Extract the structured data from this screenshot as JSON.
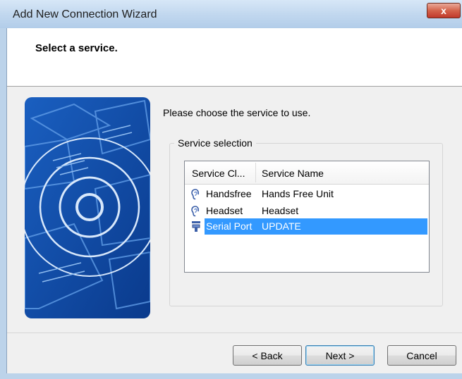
{
  "window": {
    "title": "Add New Connection Wizard",
    "close_glyph": "x"
  },
  "header": {
    "title": "Select a service."
  },
  "main": {
    "prompt": "Please choose the service to use.",
    "group_label": "Service selection",
    "columns": [
      "Service Cl...",
      "Service Name"
    ],
    "rows": [
      {
        "icon": "ear-icon",
        "service_class": "Handsfree",
        "service_name": "Hands Free Unit",
        "selected": false
      },
      {
        "icon": "ear-icon",
        "service_class": "Headset",
        "service_name": "Headset",
        "selected": false
      },
      {
        "icon": "serial-port-icon",
        "service_class": "Serial Port",
        "service_name": "UPDATE",
        "selected": true
      }
    ]
  },
  "buttons": {
    "back": "< Back",
    "next": "Next >",
    "cancel": "Cancel"
  },
  "colors": {
    "selection": "#3399ff",
    "title_bar": "#c2d8ef",
    "close": "#c0392b"
  }
}
